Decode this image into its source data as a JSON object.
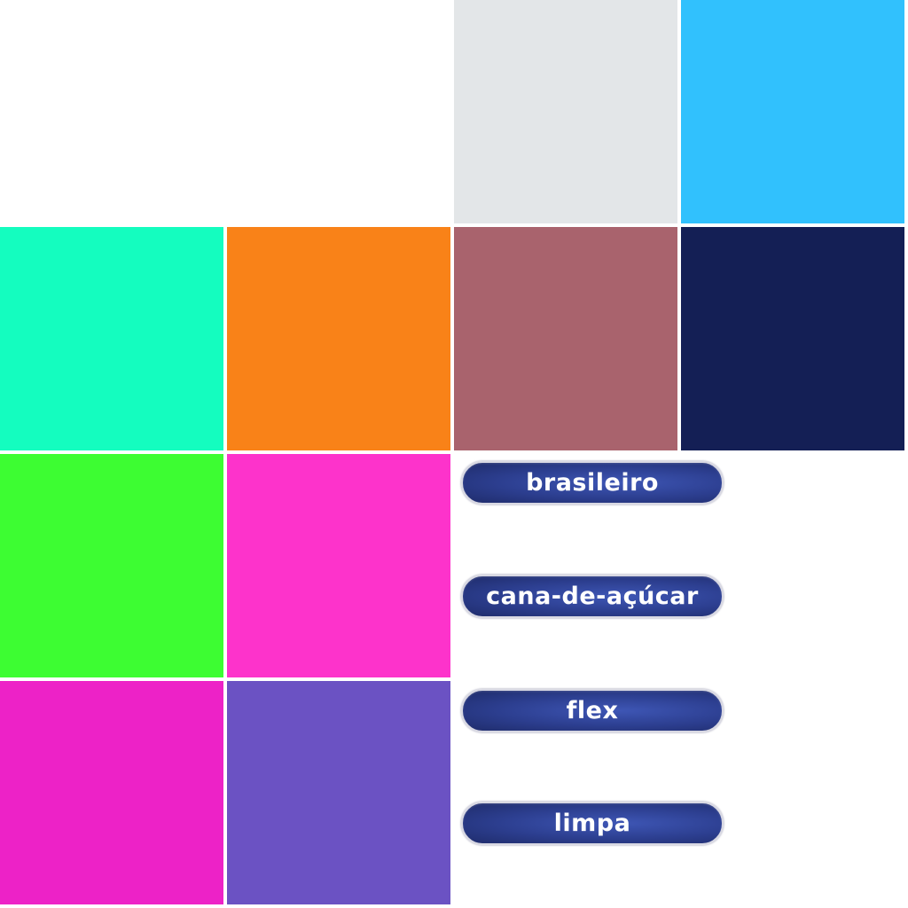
{
  "palette": {
    "swatches": [
      {
        "id": "white",
        "color": "#ffffff"
      },
      {
        "id": "light-gray",
        "color": "#e3e6e8"
      },
      {
        "id": "sky-blue",
        "color": "#31c1fd"
      },
      {
        "id": "aqua-green",
        "color": "#14fdbf"
      },
      {
        "id": "orange",
        "color": "#f98218"
      },
      {
        "id": "dusty-rose",
        "color": "#a9636d"
      },
      {
        "id": "navy",
        "color": "#141f55"
      },
      {
        "id": "lime-green",
        "color": "#3dfd32"
      },
      {
        "id": "hot-pink",
        "color": "#fd33cb"
      },
      {
        "id": "magenta",
        "color": "#ed22c7"
      },
      {
        "id": "purple",
        "color": "#6b52c3"
      }
    ]
  },
  "tags": [
    {
      "label": "brasileiro"
    },
    {
      "label": "cana-de-açúcar"
    },
    {
      "label": "flex"
    },
    {
      "label": "limpa"
    }
  ]
}
